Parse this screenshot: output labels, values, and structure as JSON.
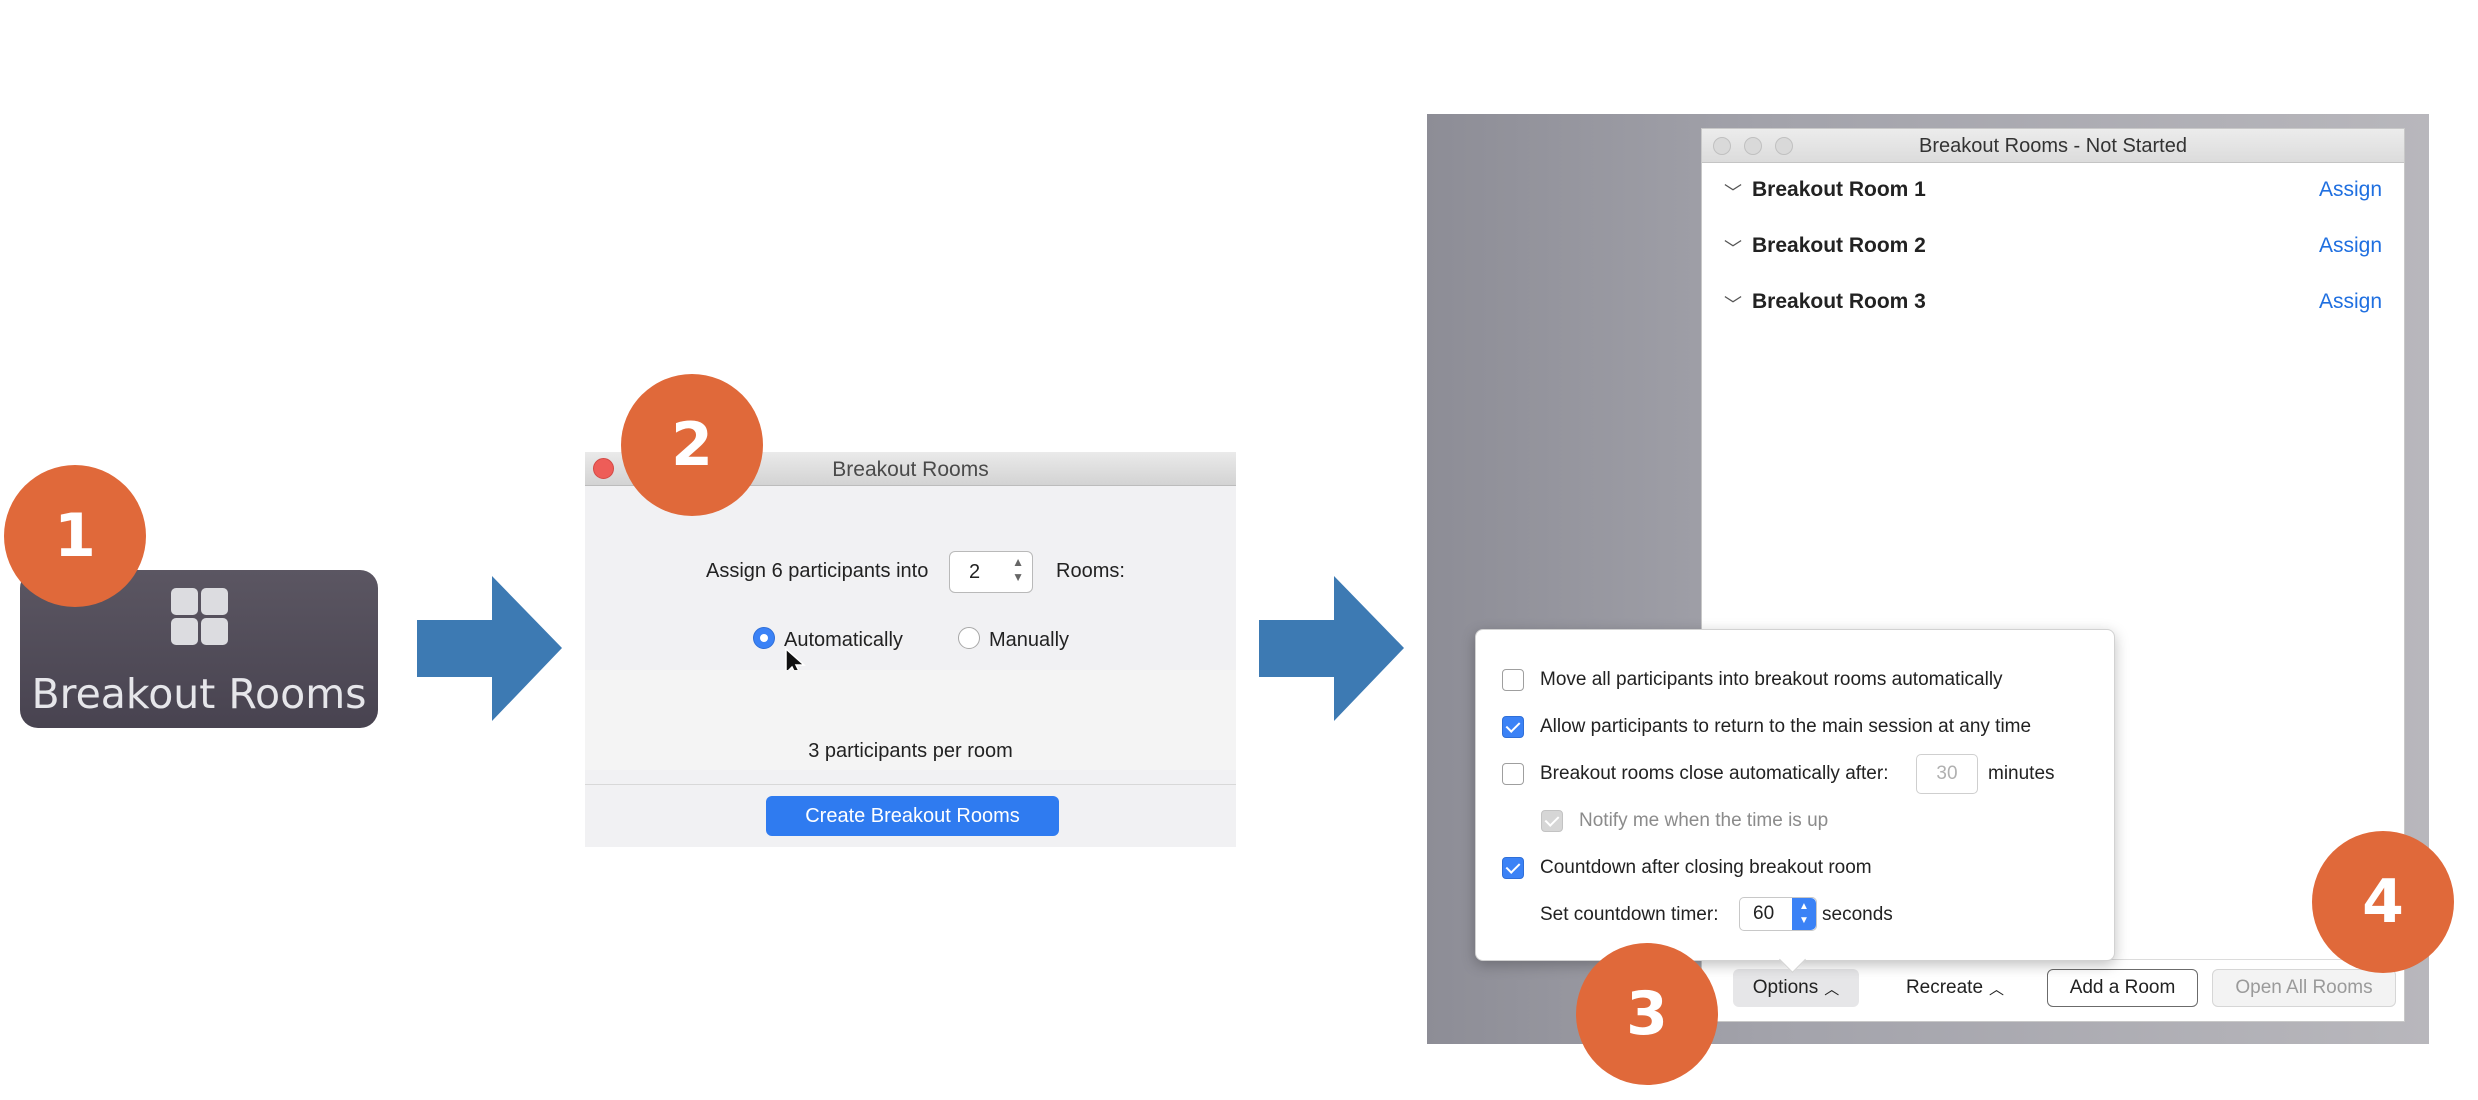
{
  "badges": [
    "1",
    "2",
    "3",
    "4"
  ],
  "step1": {
    "button_label": "Breakout Rooms",
    "icon": "grid-icon"
  },
  "step2": {
    "title": "Breakout Rooms",
    "assign_prefix": "Assign 6 participants into",
    "room_count": "2",
    "rooms_suffix": "Rooms:",
    "radio_auto": "Automatically",
    "radio_manual": "Manually",
    "per_room": "3 participants per room",
    "create_button": "Create Breakout Rooms"
  },
  "step3": {
    "title": "Breakout Rooms - Not Started",
    "rooms": [
      {
        "name": "Breakout Room 1",
        "action": "Assign"
      },
      {
        "name": "Breakout Room 2",
        "action": "Assign"
      },
      {
        "name": "Breakout Room 3",
        "action": "Assign"
      }
    ],
    "options": {
      "move_all": "Move all participants into breakout rooms automatically",
      "allow_return": "Allow participants to return to the main session at any time",
      "close_auto": "Breakout rooms close automatically after:",
      "close_minutes": "30",
      "minutes_label": "minutes",
      "notify": "Notify me when the time is up",
      "countdown": "Countdown after closing breakout room",
      "set_timer": "Set countdown timer:",
      "timer_value": "60",
      "seconds_label": "seconds"
    },
    "toolbar": {
      "options": "Options",
      "recreate": "Recreate",
      "add_room": "Add a Room",
      "open_all": "Open All Rooms"
    }
  },
  "colors": {
    "badge": "#e0693a",
    "arrow": "#3d7ab3",
    "accent_blue": "#2f7bf0",
    "link_blue": "#1f6fe0"
  }
}
